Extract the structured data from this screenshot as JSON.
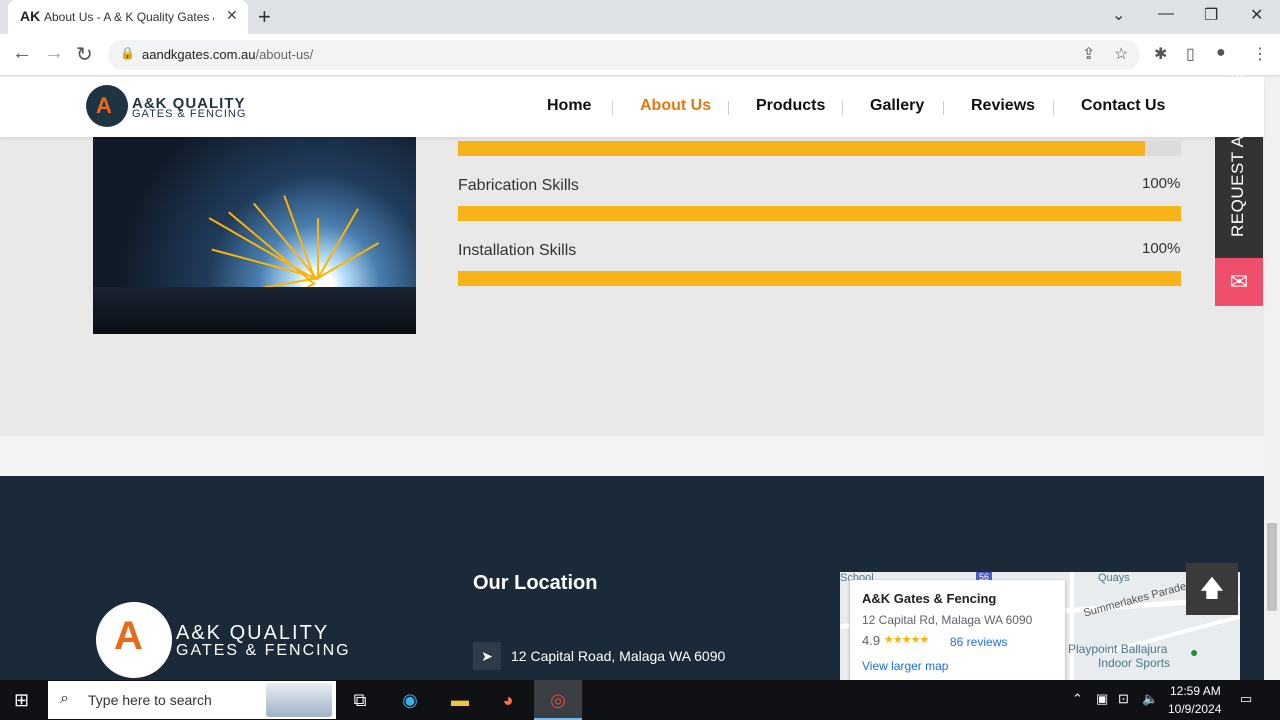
{
  "browser": {
    "tab_title": "About Us - A & K Quality Gates &",
    "tab_favicon": "AK",
    "url_domain": "aandkgates.com.au",
    "url_path": "/about-us/"
  },
  "header": {
    "logo_line1": "A&K QUALITY",
    "logo_line2": "GATES & FENCING",
    "nav": [
      "Home",
      "About Us",
      "Products",
      "Gallery",
      "Reviews",
      "Contact Us"
    ],
    "active_nav": "About Us"
  },
  "skills": [
    {
      "label": "",
      "percent_text": "",
      "fill_fraction": 0.95
    },
    {
      "label": "Fabrication Skills",
      "percent_text": "100%",
      "fill_fraction": 1.0
    },
    {
      "label": "Installation Skills",
      "percent_text": "100%",
      "fill_fraction": 1.0
    }
  ],
  "side": {
    "quote_label": "REQUEST A QUOTE",
    "mail_icon": "mail-icon"
  },
  "footer": {
    "logo_line1": "A&K QUALITY",
    "logo_line2": "GATES & FENCING",
    "location_title": "Our Location",
    "address": "12 Capital Road, Malaga WA 6090",
    "map": {
      "place_name": "A&K Gates & Fencing",
      "place_address": "12 Capital Rd, Malaga WA 6090",
      "rating": "4.9",
      "stars": "★★★★★",
      "reviews": "86 reviews",
      "view_larger": "View larger map",
      "poi1": "Playpoint Ballajura",
      "poi2": "Indoor Sports",
      "road1": "Summerlakes Parade",
      "road2": "Quays",
      "road_badge": "56",
      "label_school": "School"
    }
  },
  "taskbar": {
    "search_placeholder": "Type here to search",
    "time": "12:59 AM",
    "date": "10/9/2024"
  },
  "colors": {
    "accent_orange": "#e07a10",
    "bar_fill": "#f8b21a",
    "footer_bg": "#1b2a38",
    "quote_mail_pink": "#ee4d6b"
  }
}
